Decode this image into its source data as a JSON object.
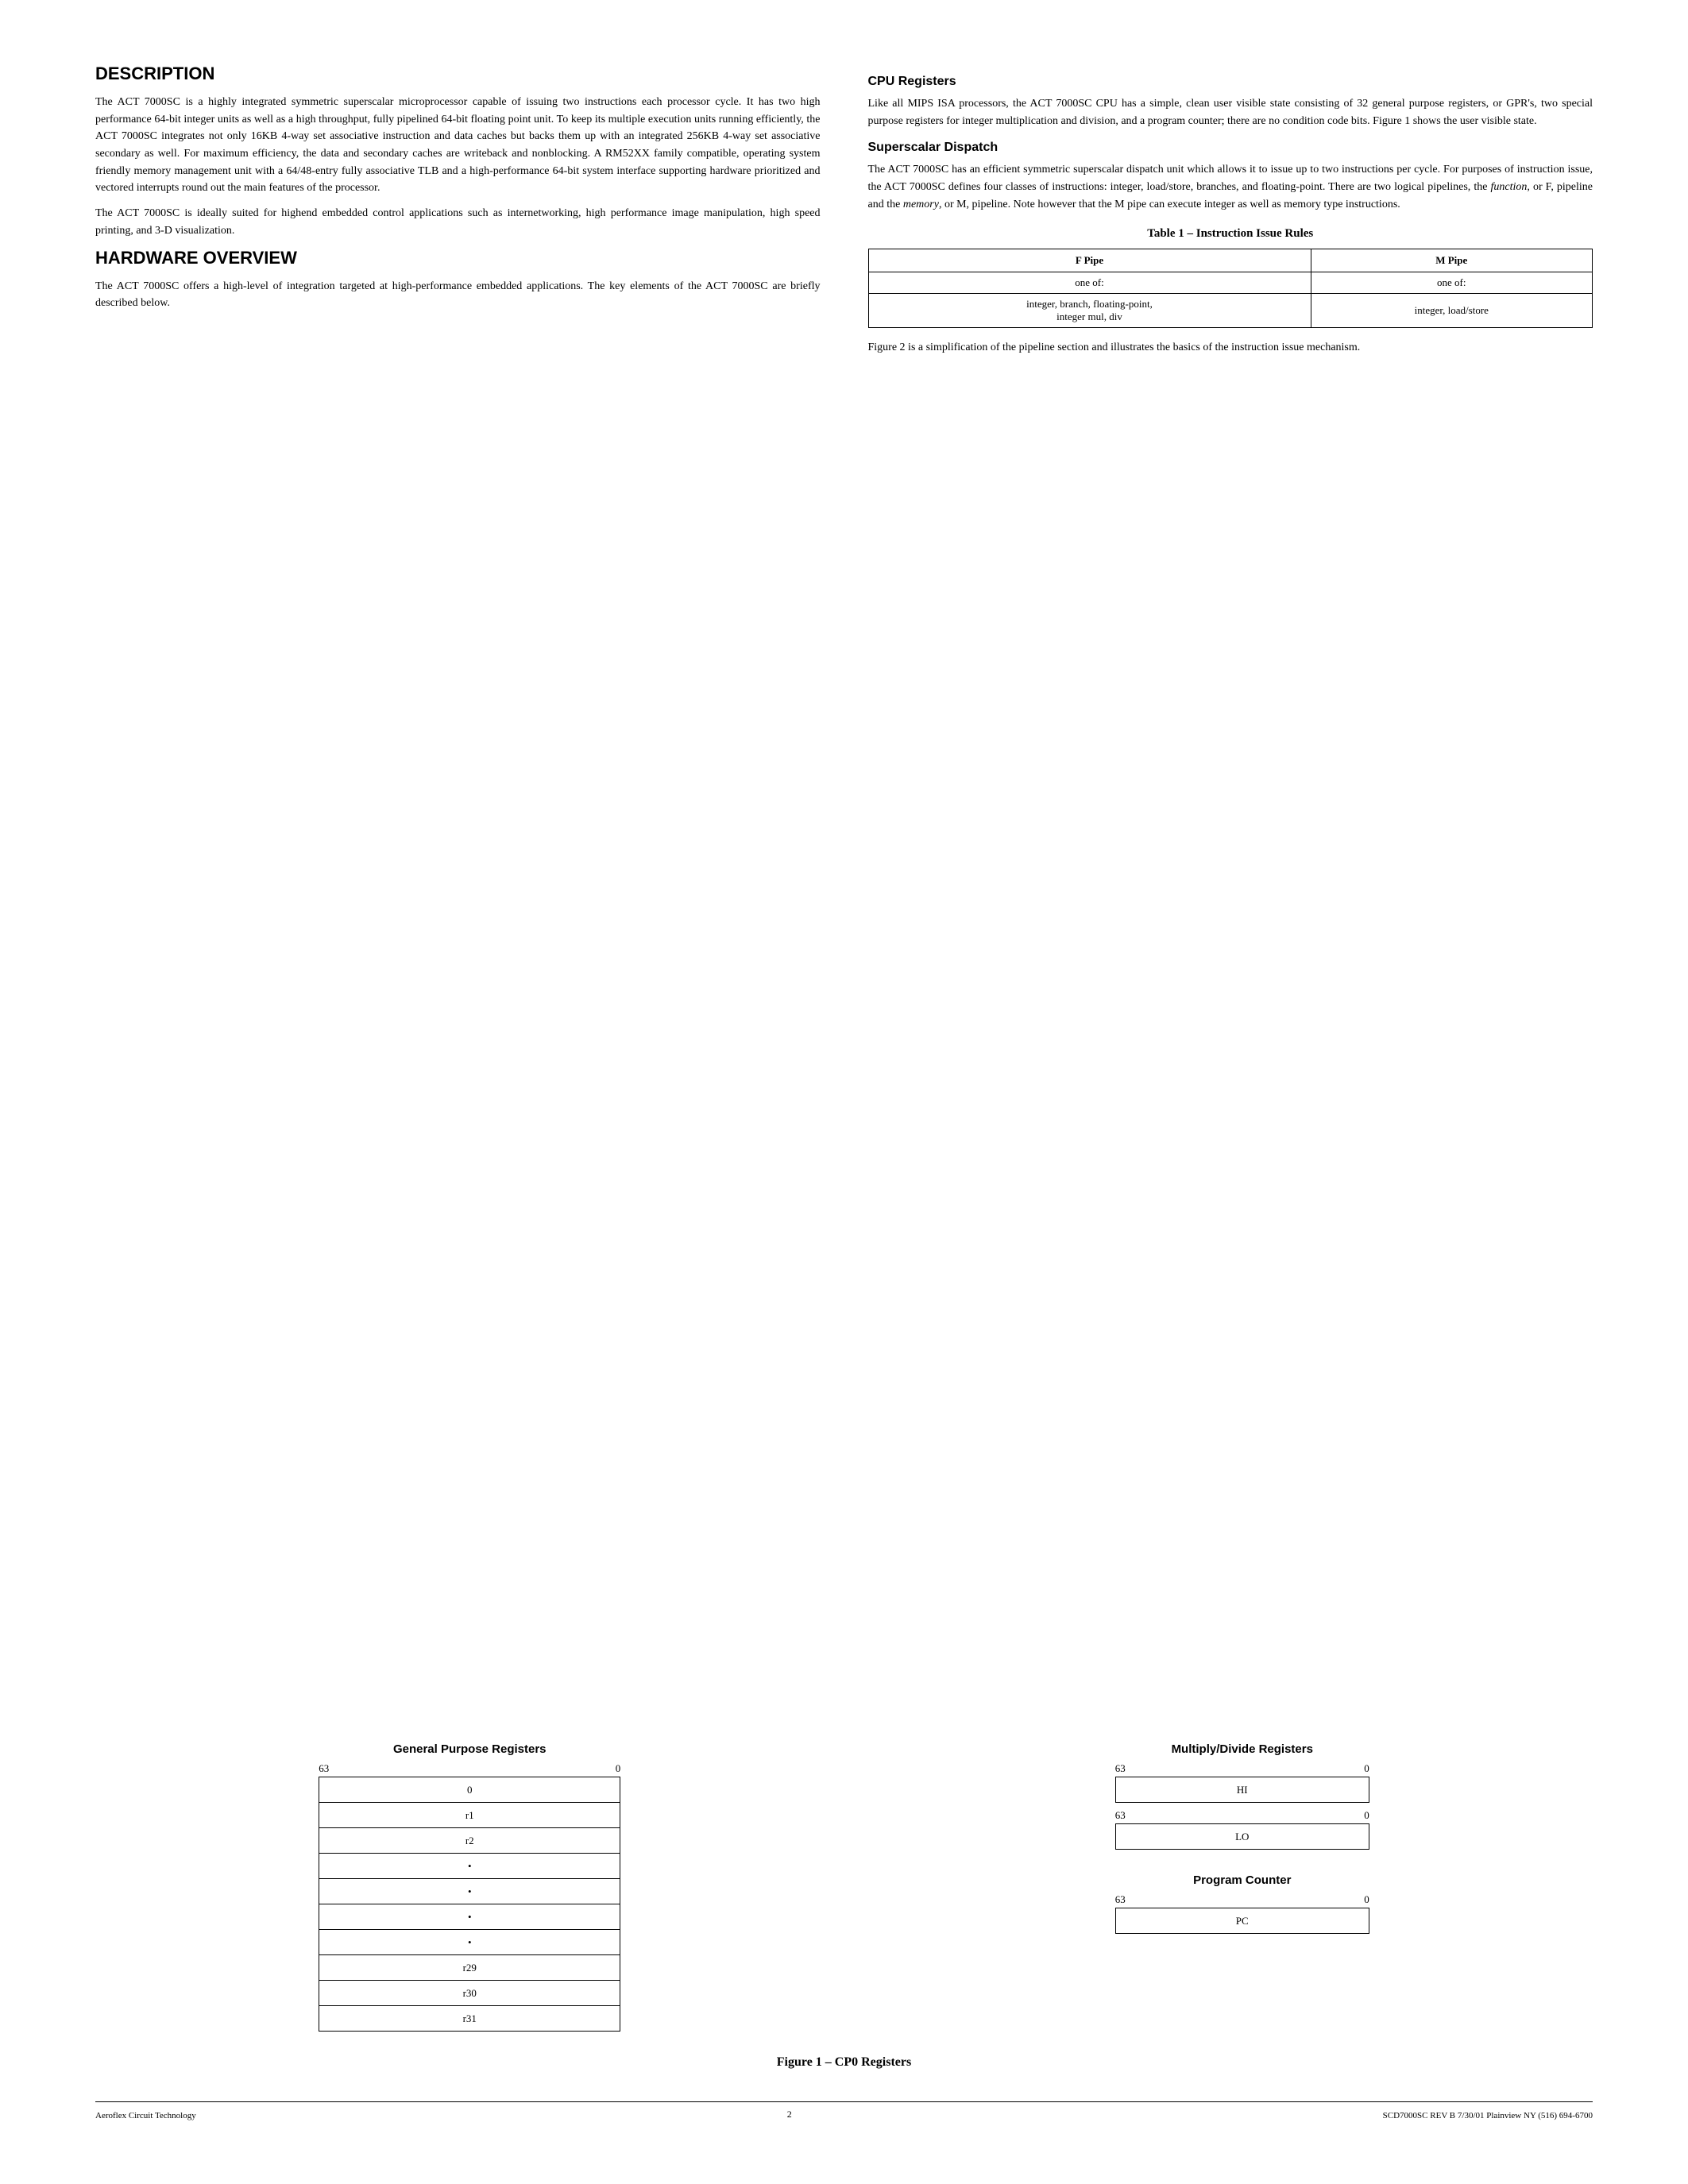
{
  "page": {
    "sections": {
      "description": {
        "title": "DESCRIPTION",
        "paragraphs": [
          "The ACT 7000SC is a highly integrated symmetric superscalar microprocessor capable of issuing two instructions each processor cycle. It has two high performance 64-bit integer units as well as a high throughput, fully pipelined 64-bit floating point unit. To keep its multiple execution units running efficiently, the ACT 7000SC integrates not only 16KB 4-way set associative instruction and data caches but backs them up with an integrated 256KB 4-way set associative secondary as well. For maximum efficiency, the data and secondary caches are writeback and nonblocking. A RM52XX family compatible, operating system friendly memory management unit with a 64/48-entry fully associative TLB and a high-performance 64-bit system interface supporting hardware prioritized and vectored interrupts round out the main features of the processor.",
          "The ACT 7000SC is ideally suited for highend embedded control applications such as internetworking, high performance image manipulation, high speed printing, and 3-D visualization."
        ]
      },
      "hardware_overview": {
        "title": "HARDWARE OVERVIEW",
        "paragraphs": [
          "The ACT 7000SC offers a high-level of integration targeted at high-performance embedded applications. The key elements of the ACT 7000SC are briefly described below."
        ]
      },
      "cpu_registers": {
        "title": "CPU Registers",
        "paragraphs": [
          "Like all MIPS ISA processors, the ACT 7000SC CPU has a simple, clean user visible state consisting of 32 general purpose registers, or GPR's, two special purpose registers for integer multiplication and division, and a program counter; there are no condition code bits. Figure 1 shows the user visible state."
        ]
      },
      "superscalar_dispatch": {
        "title": "Superscalar Dispatch",
        "paragraphs": [
          "The ACT 7000SC has an efficient symmetric superscalar dispatch unit which allows it to issue up to two instructions per cycle. For purposes of instruction issue, the ACT 7000SC defines four classes of instructions: integer, load/store, branches, and floating-point. There are two logical pipelines, the function, or F, pipeline and the memory, or M, pipeline. Note however that the M pipe can execute integer as well as memory type instructions."
        ]
      },
      "instruction_issue_table": {
        "title": "Table 1 – Instruction Issue Rules",
        "headers": [
          "F Pipe",
          "M Pipe"
        ],
        "row1": [
          "one of:",
          "one of:"
        ],
        "row2": [
          "integer, branch, floating-point,\ninteger mul, div",
          "integer, load/store"
        ]
      },
      "figure2_caption": "Figure 2 is a simplification of the pipeline section and illustrates the basics of the instruction issue mechanism."
    },
    "gpr": {
      "title": "General Purpose Registers",
      "range_left": "63",
      "range_right": "0",
      "rows": [
        "0",
        "r1",
        "r2",
        "•",
        "•",
        "•",
        "•",
        "r29",
        "r30",
        "r31"
      ]
    },
    "mul_registers": {
      "title": "Multiply/Divide Registers",
      "range_left": "63",
      "range_right": "0",
      "hi_label": "HI",
      "lo_range_left": "63",
      "lo_range_right": "0",
      "lo_label": "LO"
    },
    "program_counter": {
      "title": "Program Counter",
      "range_left": "63",
      "range_right": "0",
      "pc_label": "PC"
    },
    "figure1_caption": "Figure 1 – CP0 Registers",
    "footer": {
      "left": "Aeroflex Circuit Technology",
      "center": "2",
      "right": "SCD7000SC REV B  7/30/01 Plainview NY (516) 694-6700"
    }
  }
}
